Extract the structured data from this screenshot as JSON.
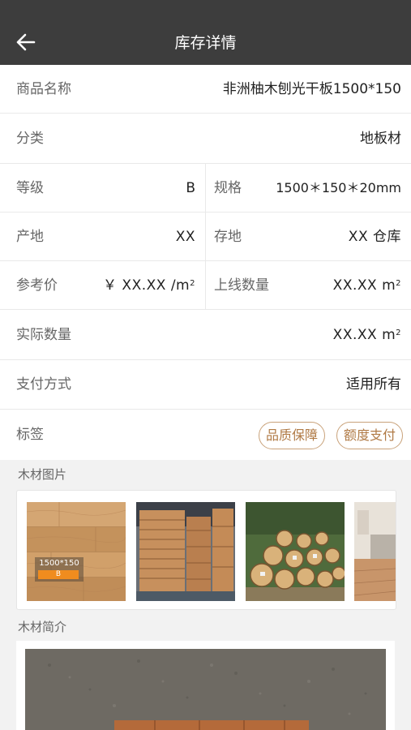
{
  "header": {
    "title": "库存详情",
    "back_icon": "arrow-left-icon"
  },
  "fields": {
    "name": {
      "label": "商品名称",
      "value": "非洲柚木刨光干板1500*150"
    },
    "category": {
      "label": "分类",
      "value": "地板材"
    },
    "grade": {
      "label": "等级",
      "value": "B"
    },
    "spec": {
      "label": "规格",
      "value": "1500＊150＊20mm"
    },
    "origin": {
      "label": "产地",
      "value": "XX"
    },
    "storage": {
      "label": "存地",
      "value": "XX 仓库"
    },
    "ref_price": {
      "label": "参考价",
      "value": "￥ XX.XX /m",
      "unit_sup": "2"
    },
    "online_qty": {
      "label": "上线数量",
      "value": "XX.XX m",
      "unit_sup": "2"
    },
    "actual_qty": {
      "label": "实际数量",
      "value": "XX.XX m",
      "unit_sup": "2"
    },
    "payment": {
      "label": "支付方式",
      "value": "适用所有"
    },
    "tags": {
      "label": "标签",
      "items": [
        "品质保障",
        "额度支付"
      ]
    }
  },
  "sections": {
    "images_title": "木材图片",
    "intro_title": "木材简介"
  },
  "thumb1_overlay": {
    "size": "1500*150",
    "grade": "B"
  },
  "colors": {
    "topbar": "#3d3d3d",
    "tag_border": "#c9a27a",
    "tag_text": "#b07a45",
    "badge": "#f08c1e"
  }
}
